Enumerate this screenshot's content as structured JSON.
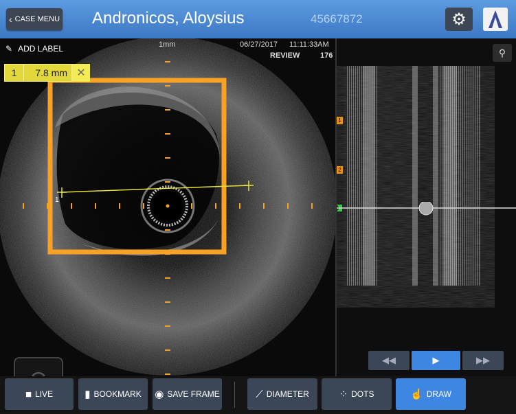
{
  "header": {
    "back_label": "CASE MENU",
    "patient_name": "Andronicos, Aloysius",
    "patient_id": "45667872",
    "settings_icon": "gear-icon",
    "logo_icon": "brand-logo-icon"
  },
  "ivus": {
    "add_label": "ADD LABEL",
    "scale_label": "1mm",
    "date": "06/27/2017",
    "time": "11:11:33AM",
    "mode": "REVIEW",
    "frame": "176",
    "measurement": {
      "index": "1",
      "value": "7.8 mm"
    },
    "measure_line_label": "1",
    "colors": {
      "roi": "#f7a125",
      "measure": "#e2d83c",
      "ticks": "#f7a125"
    }
  },
  "longview": {
    "markers": [
      "1",
      "2"
    ],
    "pin_icon": "pin-icon"
  },
  "playback": {
    "rewind_label": "◀◀",
    "play_label": "▶",
    "forward_label": "▶▶"
  },
  "toolbar": {
    "live_label": "LIVE",
    "bookmark_label": "BOOKMARK",
    "save_frame_label": "SAVE FRAME",
    "diameter_label": "DIAMETER",
    "dots_label": "DOTS",
    "draw_label": "DRAW"
  }
}
